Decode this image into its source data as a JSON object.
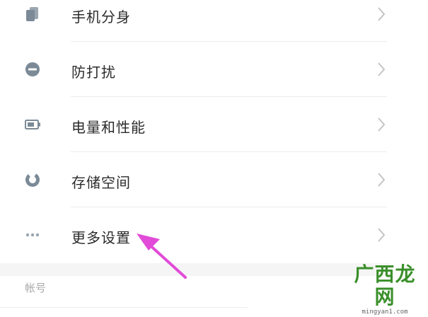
{
  "settings": {
    "items": [
      {
        "label": "手机分身",
        "icon": "phone-clone-icon"
      },
      {
        "label": "防打扰",
        "icon": "do-not-disturb-icon"
      },
      {
        "label": "电量和性能",
        "icon": "battery-icon"
      },
      {
        "label": "存储空间",
        "icon": "storage-icon"
      },
      {
        "label": "更多设置",
        "icon": "more-dots-icon"
      }
    ],
    "section_header": "帐号"
  },
  "watermark": {
    "logo": "广西龙网",
    "url": "mingyan1.com"
  },
  "colors": {
    "icon": "#7b8a96",
    "chevron": "#c4c4c4",
    "arrow": "#e24bd8",
    "watermark": "#3a8f2a"
  }
}
